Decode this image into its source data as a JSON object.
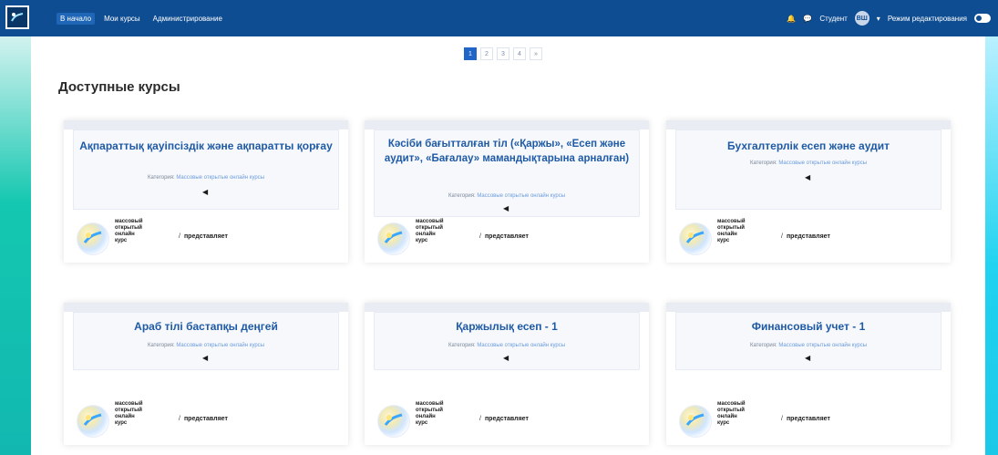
{
  "nav": {
    "links": [
      "В начало",
      "Мои курсы",
      "Администрирование"
    ],
    "right": {
      "user": "Студент",
      "avatar": "ВШ",
      "edit_mode": "Режим редактирования"
    }
  },
  "pagination": [
    "1",
    "2",
    "3",
    "4",
    "»"
  ],
  "section_title": "Доступные курсы",
  "cards": [
    {
      "title": "Ақпараттық қауіпсіздік және ақпаратты қорғау",
      "category_label": "Категория:",
      "category_value": "Массовые открытые онлайн курсы",
      "speaker_icon": "speaker-icon",
      "mooc_text": [
        "массовый",
        "открытый",
        "онлайн",
        "курс"
      ],
      "presenter": "представляет"
    },
    {
      "title": "Кәсіби бағытталған тіл («Қаржы», «Есеп және аудит», «Бағалау» мамандықтарына арналған)",
      "category_label": "Категория:",
      "category_value": "Массовые открытые онлайн курсы",
      "speaker_icon": "speaker-icon",
      "mooc_text": [
        "массовый",
        "открытый",
        "онлайн",
        "курс"
      ],
      "presenter": "представляет"
    },
    {
      "title": "Бухгалтерлік есеп және аудит",
      "category_label": "Категория:",
      "category_value": "Массовые открытые онлайн курсы",
      "speaker_icon": "speaker-icon",
      "mooc_text": [
        "массовый",
        "открытый",
        "онлайн",
        "курс"
      ],
      "presenter": "представляет"
    },
    {
      "title": "Араб тілі бастапқы деңгей",
      "category_label": "Категория:",
      "category_value": "Массовые открытые онлайн курсы",
      "speaker_icon": "speaker-icon",
      "mooc_text": [
        "массовый",
        "открытый",
        "онлайн",
        "курс"
      ],
      "presenter": "представляет"
    },
    {
      "title": "Қаржылық есеп - 1",
      "category_label": "Категория:",
      "category_value": "Массовые открытые онлайн курсы",
      "speaker_icon": "speaker-icon",
      "mooc_text": [
        "массовый",
        "открытый",
        "онлайн",
        "курс"
      ],
      "presenter": "представляет"
    },
    {
      "title": "Финансовый учет - 1",
      "category_label": "Категория:",
      "category_value": "Массовые открытые онлайн курсы",
      "speaker_icon": "speaker-icon",
      "mooc_text": [
        "массовый",
        "открытый",
        "онлайн",
        "курс"
      ],
      "presenter": "представляет"
    }
  ],
  "colors": {
    "nav_bg": "#0f4d92",
    "accent": "#1f66c8",
    "card_title": "#1f5aa6",
    "left_stripe": "#14c7b0",
    "right_stripe": "#20d3f0"
  }
}
